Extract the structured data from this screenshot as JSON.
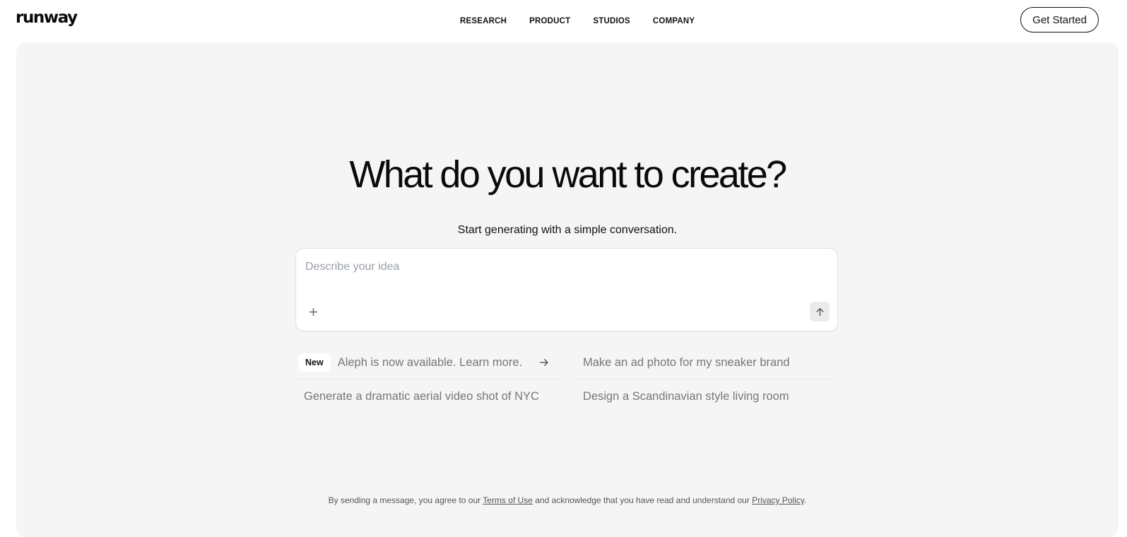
{
  "brand": {
    "logo_text": "runway"
  },
  "nav": {
    "items": [
      {
        "label": "RESEARCH"
      },
      {
        "label": "PRODUCT"
      },
      {
        "label": "STUDIOS"
      },
      {
        "label": "COMPANY"
      }
    ],
    "cta_label": "Get Started"
  },
  "hero": {
    "title": "What do you want to create?",
    "subtitle": "Start generating with a simple conversation."
  },
  "prompt": {
    "placeholder": "Describe your idea",
    "value": "",
    "add_icon": "plus-icon",
    "send_icon": "arrow-up-icon"
  },
  "suggestions": {
    "announcement": {
      "badge": "New",
      "text": "Aleph is now available. Learn more.",
      "icon": "arrow-right-icon"
    },
    "items": [
      "Make an ad photo for my sneaker brand",
      "Generate a dramatic aerial video shot of NYC",
      "Design a Scandinavian style living room"
    ]
  },
  "footer": {
    "text_before": "By sending a message, you agree to our ",
    "terms_label": "Terms of Use",
    "text_middle": " and acknowledge that you have read and understand our ",
    "privacy_label": "Privacy Policy",
    "text_after": "."
  },
  "colors": {
    "panel_bg": "#f5f5f5",
    "text_primary": "#0b0b0b",
    "text_muted": "#777777"
  }
}
